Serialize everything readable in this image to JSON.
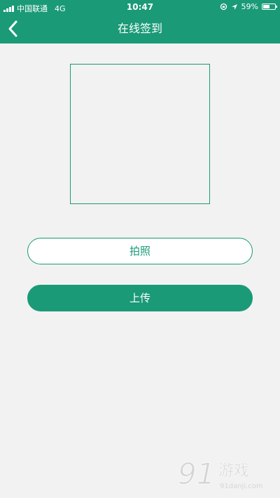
{
  "status_bar": {
    "carrier": "中国联通",
    "network": "4G",
    "time": "10:47",
    "battery": "59%",
    "battery_level": 0.59
  },
  "header": {
    "title": "在线签到",
    "back_icon": "chevron-left-icon"
  },
  "buttons": {
    "photo_label": "拍照",
    "upload_label": "上传"
  },
  "watermark": {
    "brand": "91游戏",
    "url": "91danji.com"
  },
  "colors": {
    "brand": "#1a9a77",
    "background": "#f2f2f2"
  }
}
